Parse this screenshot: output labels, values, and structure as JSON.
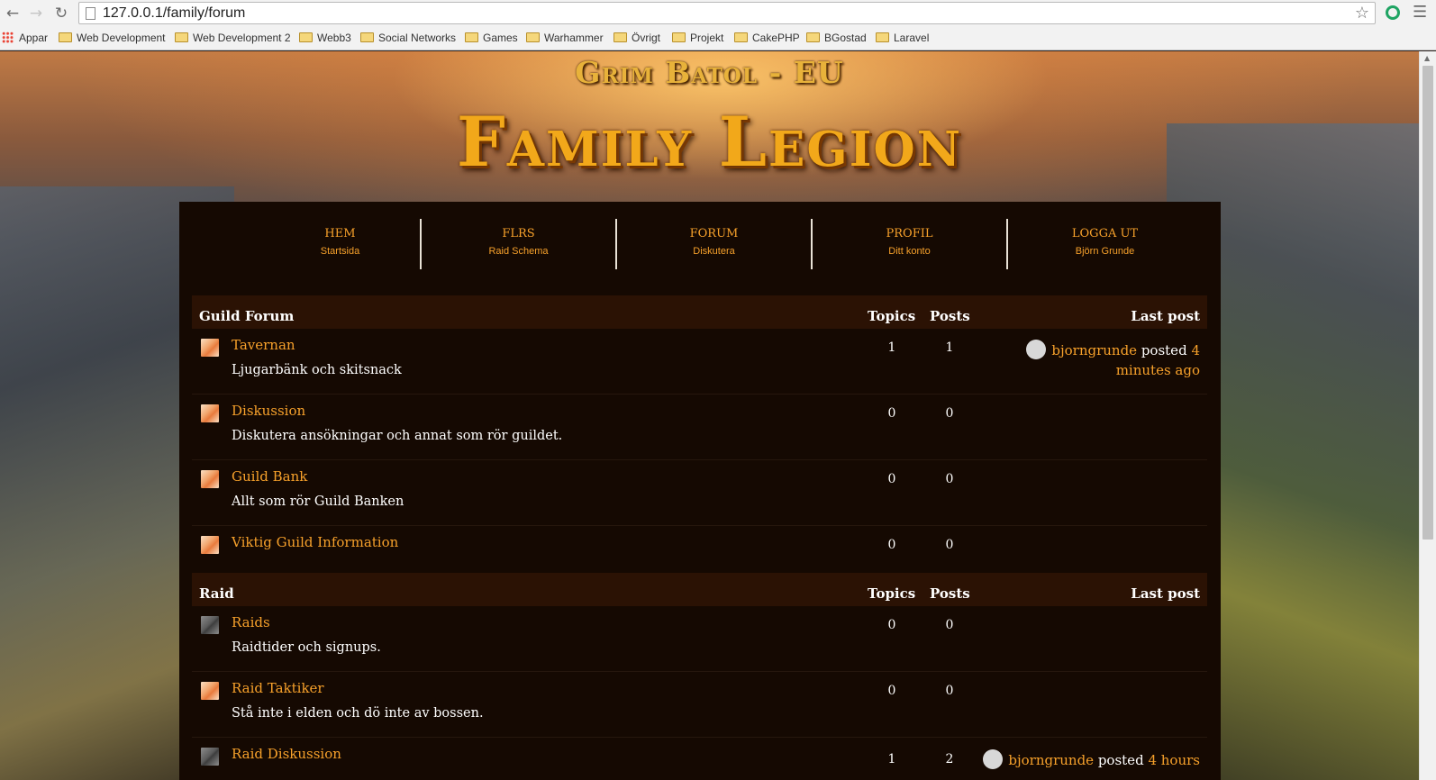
{
  "browser": {
    "url": "127.0.0.1/family/forum",
    "bookmarks": [
      "Appar",
      "Web Development",
      "Web Development 2",
      "Webb3",
      "Social Networks",
      "Games",
      "Warhammer",
      "Övrigt",
      "Projekt",
      "CakePHP",
      "BGostad",
      "Laravel"
    ]
  },
  "header": {
    "realm": "Grim Batol - EU",
    "guild": "Family Legion"
  },
  "nav": [
    {
      "title": "HEM",
      "sub": "Startsida"
    },
    {
      "title": "FLRS",
      "sub": "Raid Schema"
    },
    {
      "title": "FORUM",
      "sub": "Diskutera"
    },
    {
      "title": "PROFIL",
      "sub": "Ditt konto"
    },
    {
      "title": "LOGGA UT",
      "sub": "Björn Grunde"
    }
  ],
  "sections": [
    {
      "title": "Guild Forum",
      "col_topics": "Topics",
      "col_posts": "Posts",
      "col_last": "Last post",
      "forums": [
        {
          "name": "Tavernan",
          "desc": "Ljugarbänk och skitsnack",
          "topics": "1",
          "posts": "1",
          "last_user": "bjorngrunde",
          "last_word": "posted",
          "last_when": "4 minutes ago",
          "icon": "unread-forum-icon"
        },
        {
          "name": "Diskussion",
          "desc": "Diskutera ansökningar och annat som rör guildet.",
          "topics": "0",
          "posts": "0",
          "icon": "unread-forum-icon"
        },
        {
          "name": "Guild Bank",
          "desc": "Allt som rör Guild Banken",
          "topics": "0",
          "posts": "0",
          "icon": "unread-forum-icon"
        },
        {
          "name": "Viktig Guild Information",
          "desc": "",
          "topics": "0",
          "posts": "0",
          "icon": "unread-forum-icon"
        }
      ]
    },
    {
      "title": "Raid",
      "col_topics": "Topics",
      "col_posts": "Posts",
      "col_last": "Last post",
      "forums": [
        {
          "name": "Raids",
          "desc": "Raidtider och signups.",
          "topics": "0",
          "posts": "0",
          "icon": "read-forum-icon"
        },
        {
          "name": "Raid Taktiker",
          "desc": "Stå inte i elden och dö inte av bossen.",
          "topics": "0",
          "posts": "0",
          "icon": "unread-forum-icon"
        },
        {
          "name": "Raid Diskussion",
          "desc": "",
          "topics": "1",
          "posts": "2",
          "last_user": "bjorngrunde",
          "last_word": "posted",
          "last_when": "4 hours",
          "icon": "read-forum-icon"
        }
      ]
    }
  ],
  "colors": {
    "accent": "#f7a12b",
    "panel": "#150902",
    "header_row": "#2b1204"
  }
}
